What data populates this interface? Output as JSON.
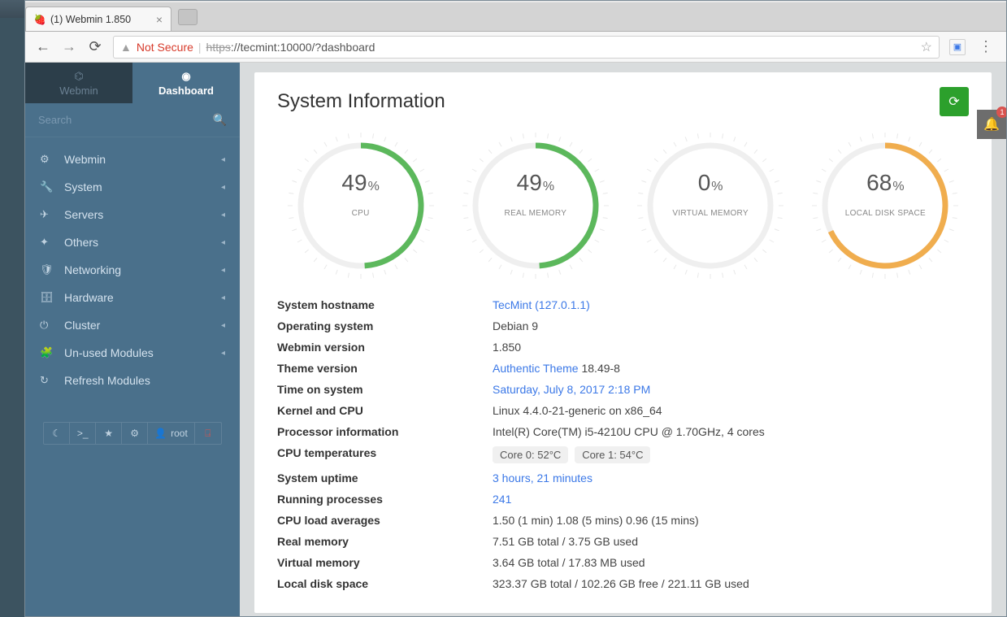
{
  "window": {
    "tab_title": "(1) Webmin 1.850",
    "not_secure": "Not Secure",
    "url_proto": "https",
    "url_rest": "://tecmint:10000/?dashboard"
  },
  "sidebar": {
    "tabs": {
      "webmin": "Webmin",
      "dashboard": "Dashboard"
    },
    "search_placeholder": "Search",
    "items": [
      {
        "icon": "⚙",
        "label": "Webmin",
        "caret": true
      },
      {
        "icon": "🔧",
        "label": "System",
        "caret": true
      },
      {
        "icon": "✈",
        "label": "Servers",
        "caret": true
      },
      {
        "icon": "✦",
        "label": "Others",
        "caret": true
      },
      {
        "icon": "🛡",
        "label": "Networking",
        "caret": true
      },
      {
        "icon": "🗄",
        "label": "Hardware",
        "caret": true
      },
      {
        "icon": "⏻",
        "label": "Cluster",
        "caret": true
      },
      {
        "icon": "🧩",
        "label": "Un-used Modules",
        "caret": true
      },
      {
        "icon": "↻",
        "label": "Refresh Modules",
        "caret": false
      }
    ],
    "user_label": "root"
  },
  "header": {
    "title": "System Information"
  },
  "gauges": [
    {
      "value": 49,
      "label": "CPU",
      "color": "#5cb85c"
    },
    {
      "value": 49,
      "label": "REAL MEMORY",
      "color": "#5cb85c"
    },
    {
      "value": 0,
      "label": "VIRTUAL MEMORY",
      "color": "#5cb85c"
    },
    {
      "value": 68,
      "label": "LOCAL DISK SPACE",
      "color": "#f0ad4e"
    }
  ],
  "info": [
    {
      "label": "System hostname",
      "value": "TecMint (127.0.1.1)",
      "link": true
    },
    {
      "label": "Operating system",
      "value": "Debian 9"
    },
    {
      "label": "Webmin version",
      "value": "1.850"
    },
    {
      "label": "Theme version",
      "value_html": "<span class='link'>Authentic Theme</span> 18.49-8"
    },
    {
      "label": "Time on system",
      "value": "Saturday, July 8, 2017 2:18 PM",
      "link": true
    },
    {
      "label": "Kernel and CPU",
      "value": "Linux 4.4.0-21-generic on x86_64"
    },
    {
      "label": "Processor information",
      "value": "Intel(R) Core(TM) i5-4210U CPU @ 1.70GHz, 4 cores"
    },
    {
      "label": "CPU temperatures",
      "badges": [
        "Core 0: 52°C",
        "Core 1: 54°C"
      ]
    },
    {
      "label": "System uptime",
      "value": "3 hours, 21 minutes",
      "link": true
    },
    {
      "label": "Running processes",
      "value": "241",
      "link": true
    },
    {
      "label": "CPU load averages",
      "value": "1.50 (1 min) 1.08 (5 mins) 0.96 (15 mins)"
    },
    {
      "label": "Real memory",
      "value": "7.51 GB total / 3.75 GB used"
    },
    {
      "label": "Virtual memory",
      "value": "3.64 GB total / 17.83 MB used"
    },
    {
      "label": "Local disk space",
      "value": "323.37 GB total / 102.26 GB free / 221.11 GB used"
    }
  ],
  "notif_count": "1",
  "chart_data": {
    "type": "pie",
    "series": [
      {
        "name": "CPU",
        "values": [
          49
        ],
        "unit": "%",
        "color": "#5cb85c"
      },
      {
        "name": "REAL MEMORY",
        "values": [
          49
        ],
        "unit": "%",
        "color": "#5cb85c"
      },
      {
        "name": "VIRTUAL MEMORY",
        "values": [
          0
        ],
        "unit": "%",
        "color": "#5cb85c"
      },
      {
        "name": "LOCAL DISK SPACE",
        "values": [
          68
        ],
        "unit": "%",
        "color": "#f0ad4e"
      }
    ],
    "ylim": [
      0,
      100
    ]
  }
}
